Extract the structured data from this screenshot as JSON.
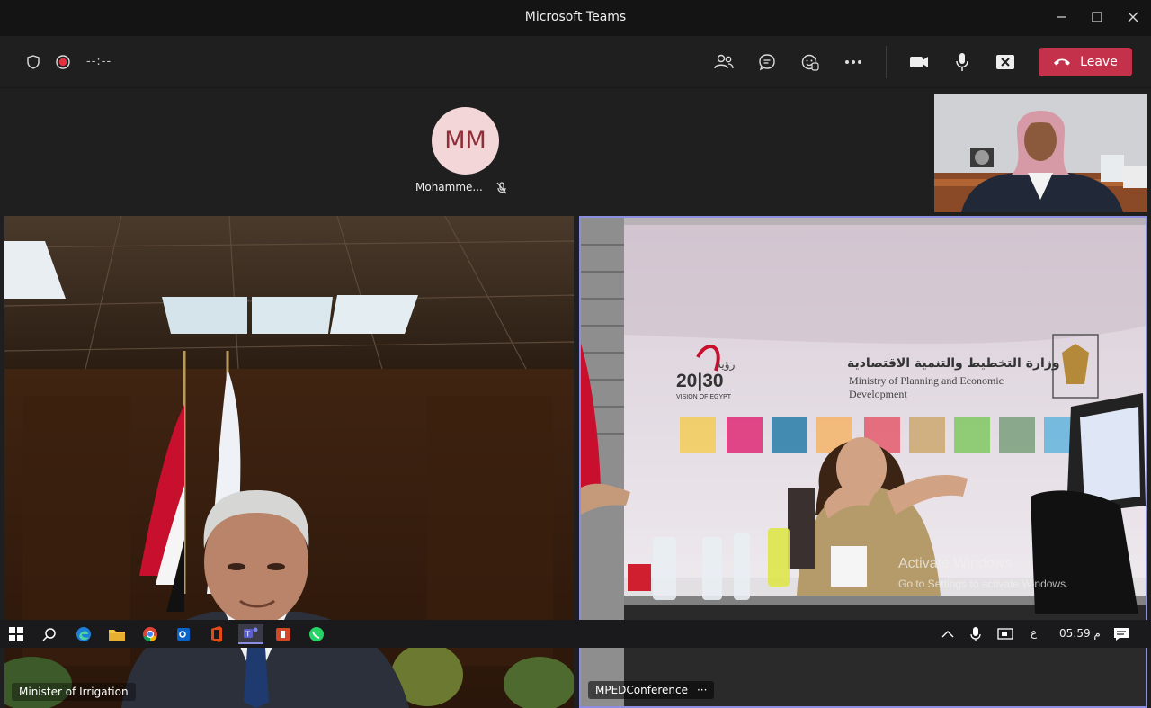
{
  "window": {
    "title": "Microsoft Teams"
  },
  "toolbar": {
    "timer": "--:--",
    "leave_label": "Leave"
  },
  "participants": {
    "avatar_initials": "MM",
    "avatar_name": "Mohamme...",
    "left_tile_name": "Minister of Irrigation",
    "right_tile_name": "MPEDConference",
    "right_tile_more": "···"
  },
  "banner": {
    "vision_arabic": "رؤية",
    "vision_year": "20|30",
    "vision_caption": "VISION OF EGYPT",
    "ministry_arabic": "وزارة التخطيط والتنمية الاقتصادية",
    "ministry_line1": "Ministry of Planning and Economic",
    "ministry_line2": "Development"
  },
  "watermark": {
    "line1": "Activate Windows",
    "line2": "Go to Settings to activate Windows."
  },
  "taskbar": {
    "lang": "ع",
    "time": "05:59 م"
  },
  "colors": {
    "leave": "#c4314b",
    "active_border": "#8c8ee0",
    "avatar_bg": "#f3d6d8",
    "avatar_fg": "#8e2f38"
  },
  "icons": [
    "shield-icon",
    "record-icon",
    "participants-icon",
    "chat-icon",
    "reactions-icon",
    "more-icon",
    "camera-icon",
    "mic-icon",
    "share-stop-icon",
    "phone-icon"
  ]
}
